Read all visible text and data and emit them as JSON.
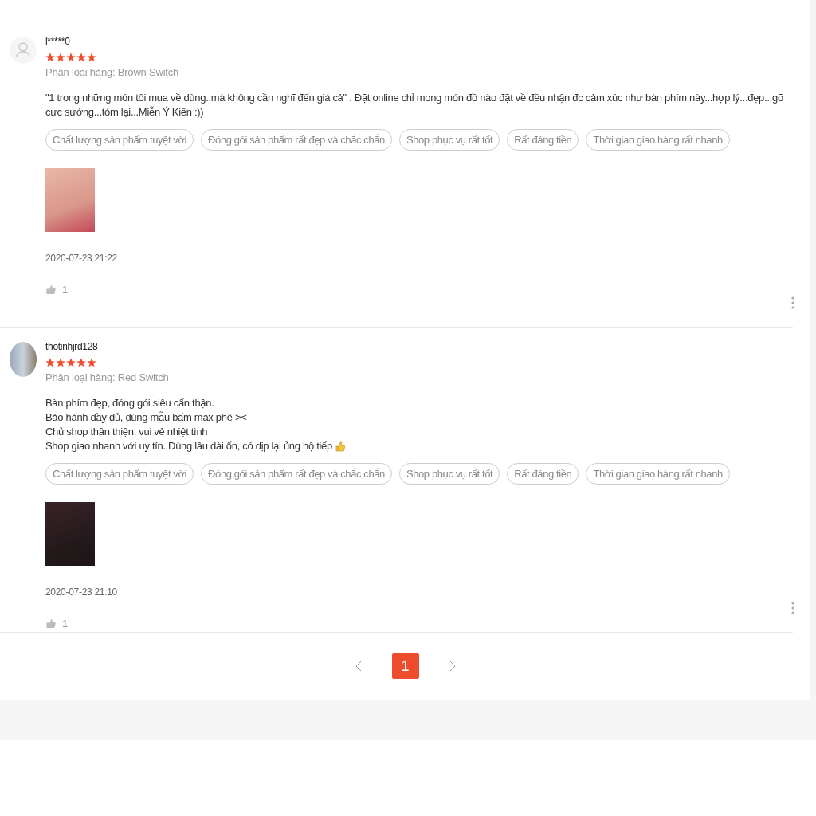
{
  "reviews": [
    {
      "username": "l*****0",
      "default_avatar": true,
      "stars": 5,
      "variation": "Phân loại hàng: Brown Switch",
      "comment_lines": [
        "\"1 trong những món tôi mua về dùng..mà không cần nghĩ đến giá cả\"    .    Đặt online chỉ mong món đồ nào đặt về đều nhận đc cảm xúc như bàn phím này...hợp lý...đẹp...gõ cực sướng...tóm lại...Miễn Ý Kiến :))"
      ],
      "thumbs_emoji": false,
      "tags": [
        "Chất lượng sản phẩm tuyệt vời",
        "Đóng gói sản phẩm rất đẹp và chắc chắn",
        "Shop phục vụ rất tốt",
        "Rất đáng tiền",
        "Thời gian giao hàng rất nhanh"
      ],
      "dark_photo": false,
      "time": "2020-07-23 21:22",
      "likes": "1"
    },
    {
      "username": "thotinhjrd128",
      "default_avatar": false,
      "stars": 5,
      "variation": "Phân loại hàng: Red Switch",
      "comment_lines": [
        "Bàn phím đẹp, đóng gói siêu cẩn thận.",
        "Bảo hành đầy đủ, đúng mẫu bấm max phê ><",
        "Chủ shop thân thiện, vui vẻ nhiệt tình",
        "Shop giao nhanh với uy tín. Dùng lâu dài ổn, có dịp lại ủng hộ tiếp"
      ],
      "thumbs_emoji": true,
      "tags": [
        "Chất lượng sản phẩm tuyệt vời",
        "Đóng gói sản phẩm rất đẹp và chắc chắn",
        "Shop phục vụ rất tốt",
        "Rất đáng tiền",
        "Thời gian giao hàng rất nhanh"
      ],
      "dark_photo": true,
      "time": "2020-07-23 21:10",
      "likes": "1"
    }
  ],
  "pagination": {
    "pages": [
      {
        "label": "1",
        "selected": true
      }
    ]
  }
}
